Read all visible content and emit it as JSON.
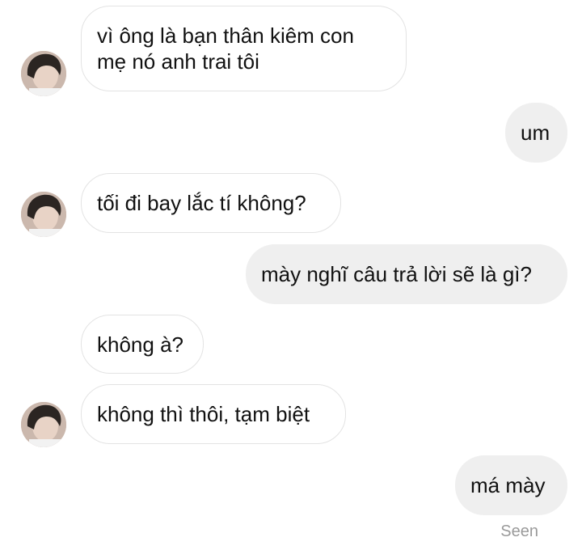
{
  "messages": [
    {
      "side": "in",
      "lines": [
        "vì ông là bạn thân kiêm con",
        "mẹ nó anh trai tôi"
      ]
    },
    {
      "side": "out",
      "lines": [
        "um"
      ]
    },
    {
      "side": "in",
      "lines": [
        "tối đi bay lắc tí không?"
      ]
    },
    {
      "side": "out",
      "lines": [
        "mày nghĩ câu trả lời sẽ là gì?"
      ]
    },
    {
      "side": "in",
      "lines": [
        "không à?"
      ]
    },
    {
      "side": "in",
      "lines": [
        "không thì thôi, tạm biệt"
      ]
    },
    {
      "side": "out",
      "lines": [
        "má mày"
      ]
    }
  ],
  "status": {
    "seen": "Seen"
  },
  "colors": {
    "incoming_bubble": "#ffffff",
    "incoming_border": "#e3e3e3",
    "outgoing_bubble": "#efefef",
    "seen_text": "#9a9a9a"
  }
}
